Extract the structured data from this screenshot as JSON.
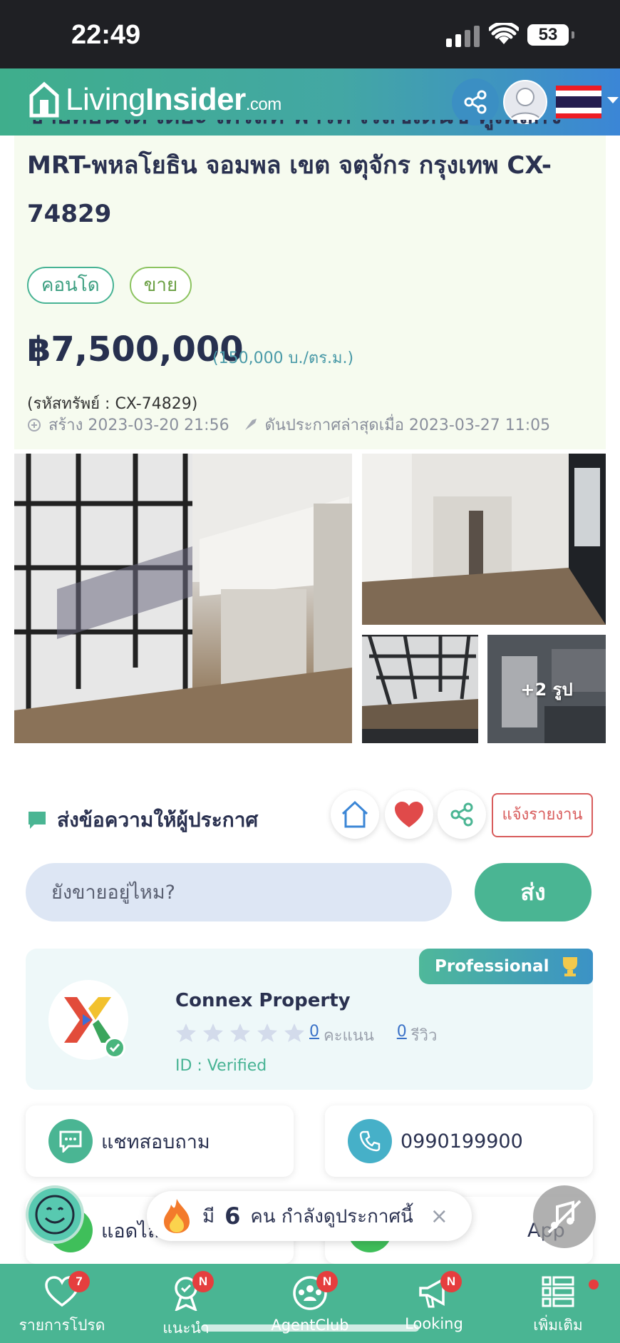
{
  "status_bar": {
    "time": "22:49",
    "battery": "53"
  },
  "header": {
    "logo_living": "Living",
    "logo_insider": "Insider",
    "logo_com": ".com"
  },
  "listing": {
    "title_line_cut": "ขายคอนโด เดอะ เครสท์ พาร์ค เรสซิเดนซ์ คู่เพลิกจ",
    "title_line2": "MRT-พหลโยธิน จอมพล เขต จตุจักร กรุงเทพ CX-",
    "title_line3": "74829",
    "chips": [
      "คอนโด",
      "ขาย"
    ],
    "price": "฿7,500,000",
    "price_per_sqm": "(150,000 บ./ตร.ม.)",
    "code": "(รหัสทรัพย์ : CX-74829)",
    "created": "สร้าง 2023-03-20 21:56",
    "bumped": "ดันประกาศล่าสุดเมื่อ 2023-03-27 11:05",
    "more_photos": "+2 รูป"
  },
  "contact": {
    "title": "ส่งข้อความให้ผู้ประกาศ",
    "report": "แจ้งรายงาน",
    "message_placeholder": "ยังขายอยู่ไหม?",
    "send": "ส่ง"
  },
  "agent": {
    "badge": "Professional",
    "name": "Connex Property",
    "score_count": "0",
    "score_label": "คะแนน",
    "review_count": "0",
    "review_label": "รีวิว",
    "id_status": "ID : Verified"
  },
  "buttons": {
    "chat": "แชทสอบถาม",
    "phone": "0990199900",
    "line": "แอดไลน์",
    "whatsapp": "App"
  },
  "viewers": {
    "prefix": "มี",
    "count": "6",
    "suffix": "คน กำลังดูประกาศนี้",
    "close": "×"
  },
  "bottom_nav": [
    {
      "label": "รายการโปรด",
      "badge": "7"
    },
    {
      "label": "แนะนำ",
      "badge": "N"
    },
    {
      "label": "AgentClub",
      "badge": "N"
    },
    {
      "label": "Looking",
      "badge": "N"
    },
    {
      "label": "เพิ่มเติม",
      "badge": ""
    }
  ],
  "colors": {
    "brand_green": "#4ab593",
    "brand_blue": "#3b86d6",
    "alert_red": "#e53e3e"
  },
  "icons": [
    "share-icon",
    "avatar-icon",
    "thai-flag-icon",
    "chat-bubble-icon",
    "home-icon",
    "heart-icon",
    "phone-icon",
    "trophy-icon",
    "smiley-icon",
    "fire-icon",
    "mute-icon",
    "menu-icon"
  ]
}
